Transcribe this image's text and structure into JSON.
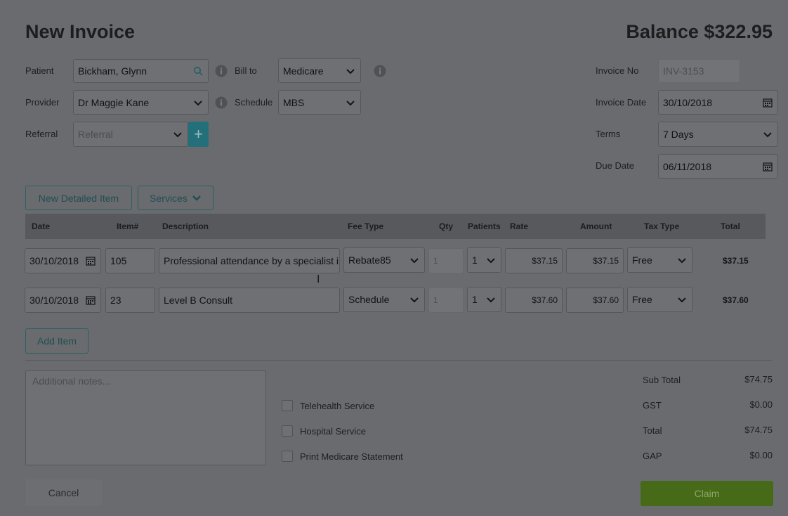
{
  "header": {
    "title": "New Invoice",
    "balance": "Balance $322.95"
  },
  "form": {
    "patient_label": "Patient",
    "patient_value": "Bickham, Glynn",
    "bill_to_label": "Bill to",
    "bill_to_value": "Medicare",
    "provider_label": "Provider",
    "provider_value": "Dr Maggie Kane",
    "schedule_label": "Schedule",
    "schedule_value": "MBS",
    "referral_label": "Referral",
    "referral_placeholder": "Referral",
    "invoice_no_label": "Invoice No",
    "invoice_no_value": "INV-3153",
    "invoice_date_label": "Invoice Date",
    "invoice_date_value": "30/10/2018",
    "terms_label": "Terms",
    "terms_value": "7 Days",
    "due_date_label": "Due Date",
    "due_date_value": "06/11/2018"
  },
  "toolbar": {
    "new_detailed_item": "New Detailed Item",
    "services": "Services"
  },
  "table": {
    "headers": [
      "Date",
      "Item#",
      "Description",
      "Fee Type",
      "Qty",
      "Patients",
      "Rate",
      "Amount",
      "Tax Type",
      "Total"
    ],
    "rows": [
      {
        "date": "30/10/2018",
        "item": "105",
        "description": "Professional attendance by a specialist in",
        "fee_type": "Rebate85",
        "qty": "1",
        "patients": "1",
        "rate": "$37.15",
        "amount": "$37.15",
        "tax_type": "Free",
        "total": "$37.15"
      },
      {
        "date": "30/10/2018",
        "item": "23",
        "description": "Level B Consult",
        "fee_type": "Schedule",
        "qty": "1",
        "patients": "1",
        "rate": "$37.60",
        "amount": "$37.60",
        "tax_type": "Free",
        "total": "$37.60"
      }
    ]
  },
  "add_item": "Add Item",
  "notes_placeholder": "Additional notes...",
  "checkboxes": [
    "Telehealth Service",
    "Hospital Service",
    "Print Medicare Statement"
  ],
  "summary": [
    {
      "label": "Sub Total",
      "value": "$74.75"
    },
    {
      "label": "GST",
      "value": "$0.00"
    },
    {
      "label": "Total",
      "value": "$74.75"
    },
    {
      "label": "GAP",
      "value": "$0.00"
    }
  ],
  "footer": {
    "cancel": "Cancel",
    "claim": "Claim"
  },
  "colors": {
    "accent": "#24707a",
    "claim": "#466a18",
    "overlay_bg": "#6a6b6e"
  }
}
